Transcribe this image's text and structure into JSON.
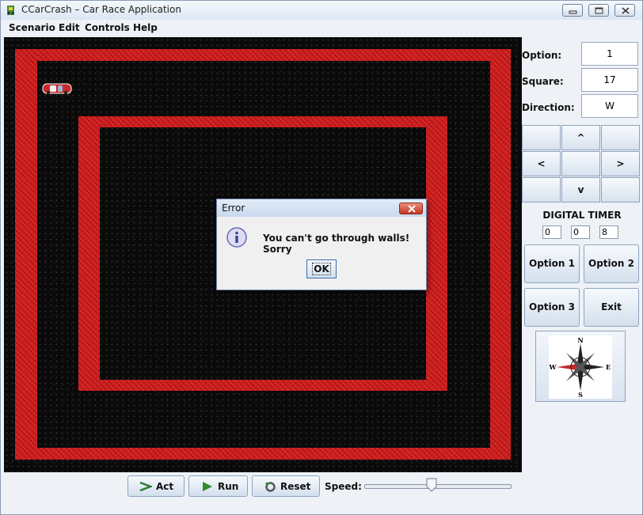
{
  "window": {
    "title": "CCarCrash – Car Race Application"
  },
  "menu": {
    "items": [
      "Scenario",
      "Edit",
      "Controls",
      "Help"
    ]
  },
  "status": {
    "option_label": "Option:",
    "option_value": "1",
    "square_label": "Square:",
    "square_value": "17",
    "direction_label": "Direction:",
    "direction_value": "W"
  },
  "pad": {
    "up": "^",
    "left": "<",
    "right": ">",
    "down": "v"
  },
  "timer": {
    "title": "DIGITAL TIMER",
    "values": [
      "0",
      "0",
      "8"
    ]
  },
  "options": {
    "option1": "Option 1",
    "option2": "Option 2",
    "option3": "Option 3",
    "exit": "Exit"
  },
  "compass": {
    "n": "N",
    "s": "S",
    "e": "E",
    "w": "W"
  },
  "controls": {
    "act": "Act",
    "run": "Run",
    "reset": "Reset",
    "speed_label": "Speed:",
    "speed_fraction": 0.46
  },
  "dialog": {
    "title": "Error",
    "message": "You can't go through walls! Sorry",
    "ok_label": "OK"
  },
  "colors": {
    "wall": "#d41e1e",
    "board": "#0a0a0a",
    "car": "#c62a2a"
  },
  "icons": {
    "app": "car-app-icon",
    "info": "info-icon",
    "compass": "compass-rose-icon",
    "act": "arrow-right-icon",
    "run": "play-icon",
    "reset": "reset-icon"
  }
}
